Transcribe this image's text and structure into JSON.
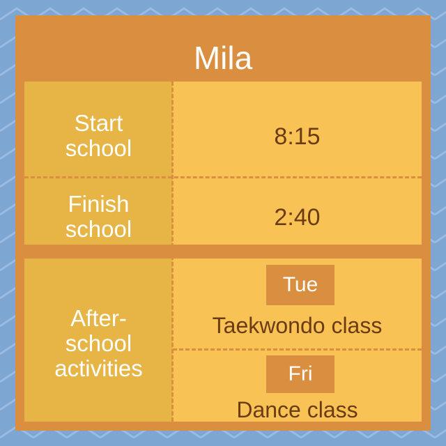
{
  "colors": {
    "background": "#7ea6d3",
    "frame": "#d98f3f",
    "label_cell": "#e6b545",
    "value_cell": "#f8c255",
    "value_text": "#6b3b14",
    "label_text": "#ffffff"
  },
  "title": "Mila",
  "rows": {
    "start": {
      "label": "Start\nschool",
      "value": "8:15"
    },
    "finish": {
      "label": "Finish\nschool",
      "value": "2:40"
    },
    "after": {
      "label": "After-\nschool\nactivities",
      "items": [
        {
          "day": "Tue",
          "activity": "Taekwondo class"
        },
        {
          "day": "Fri",
          "activity": "Dance class"
        }
      ]
    }
  }
}
